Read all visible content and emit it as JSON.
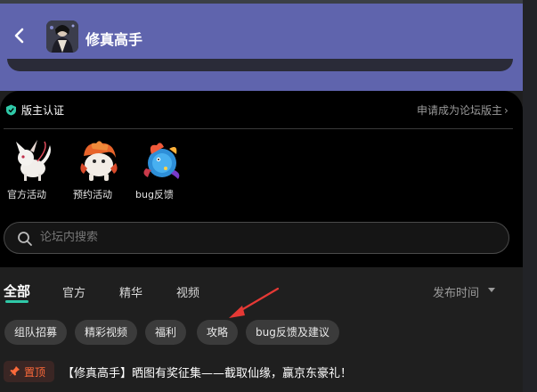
{
  "header": {
    "title": "修真高手",
    "back_icon": "chevron-left-icon"
  },
  "moderator": {
    "title": "版主认证",
    "apply_label": "申请成为论坛版主",
    "apply_chevron": "›",
    "badge_color": "#2fc9a8"
  },
  "categories": [
    {
      "label": "官方活动",
      "icon": "white-fox-icon"
    },
    {
      "label": "预约活动",
      "icon": "fire-lion-icon"
    },
    {
      "label": "bug反馈",
      "icon": "blue-bird-icon"
    }
  ],
  "search": {
    "placeholder": "论坛内搜索"
  },
  "tabs": [
    {
      "label": "全部"
    },
    {
      "label": "官方"
    },
    {
      "label": "精华"
    },
    {
      "label": "视频"
    }
  ],
  "sort": {
    "label": "发布时间"
  },
  "chips": [
    {
      "label": "组队招募"
    },
    {
      "label": "精彩视频"
    },
    {
      "label": "福利"
    },
    {
      "label": "攻略"
    },
    {
      "label": "bug反馈及建议"
    }
  ],
  "pinned_post": {
    "badge": "置顶",
    "title": "【修真高手】晒图有奖征集——截取仙缘，赢京东豪礼！"
  },
  "colors": {
    "header_bg": "#5f64ad",
    "accent": "#2fc9a8",
    "pin_orange": "#ff6a3a",
    "annotation_red": "#e53935"
  }
}
